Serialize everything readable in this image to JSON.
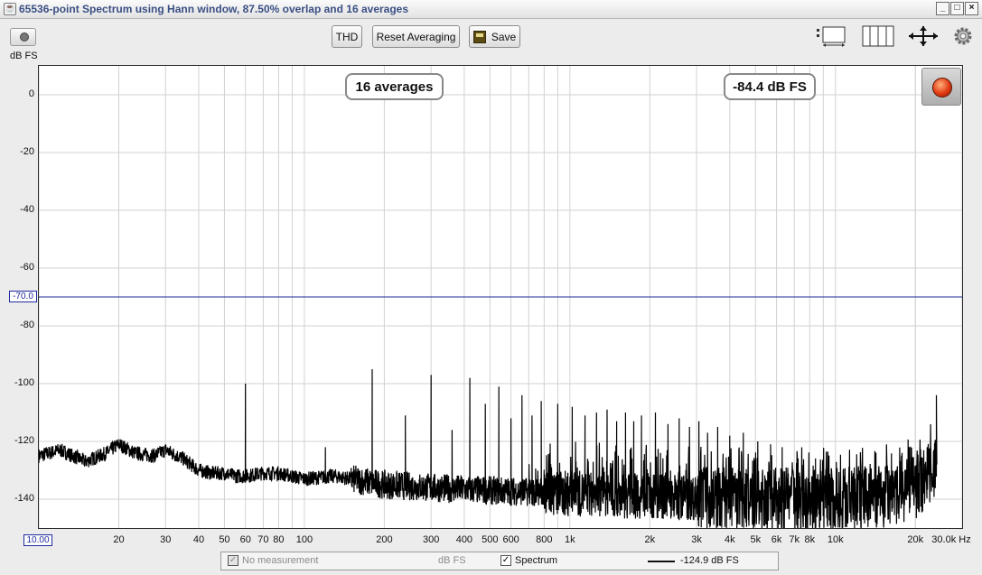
{
  "window": {
    "title": "65536-point Spectrum using Hann window, 87.50% overlap and 16 averages"
  },
  "toolbar": {
    "thd_label": "THD",
    "reset_label": "Reset Averaging",
    "save_label": "Save",
    "y_unit_label": "dB FS"
  },
  "icons": {
    "app": "java-icon",
    "camera": "camera-icon",
    "layout": "layout-icon",
    "columns": "columns-icon",
    "expand": "expand-arrows-icon",
    "settings": "gear-icon",
    "record": "record-icon"
  },
  "callouts": {
    "averages": "16 averages",
    "level": "-84.4 dB FS"
  },
  "markers": {
    "y_cursor": "-70.0",
    "x_cursor": "10.00"
  },
  "legend": {
    "no_measurement": "No measurement",
    "unit": "dB FS",
    "spectrum": "Spectrum",
    "spectrum_value": "-124.9 dB FS",
    "no_measurement_checked": true,
    "spectrum_checked": true
  },
  "colors": {
    "title_text": "#3a4f84",
    "trace": "#000000",
    "cursor": "#1d2a9e",
    "grid": "#d2d2d2"
  },
  "chart_data": {
    "type": "line",
    "x_scale": "log",
    "xlim": [
      10,
      30000
    ],
    "ylim": [
      -150,
      10
    ],
    "y_ticks": [
      0,
      -20,
      -40,
      -60,
      -80,
      -100,
      -120,
      -140
    ],
    "y_tick_labels": [
      "0",
      "-20",
      "-40",
      "-60",
      "-80",
      "-100",
      "-120",
      "-140"
    ],
    "x_ticks": [
      20,
      30,
      40,
      50,
      60,
      70,
      80,
      100,
      200,
      300,
      400,
      500,
      600,
      800,
      1000,
      2000,
      3000,
      4000,
      5000,
      6000,
      7000,
      8000,
      10000,
      20000
    ],
    "x_tick_labels": [
      "20",
      "30",
      "40",
      "50",
      "60",
      "70",
      "80",
      "100",
      "200",
      "300",
      "400",
      "500",
      "600",
      "800",
      "1k",
      "2k",
      "3k",
      "4k",
      "5k",
      "6k",
      "7k",
      "8k",
      "10k",
      "20k"
    ],
    "x_axis_end_label": "30.0k Hz",
    "cursor_y": -70,
    "noise_floor": [
      [
        10,
        -125
      ],
      [
        12,
        -123
      ],
      [
        15,
        -127
      ],
      [
        18,
        -124
      ],
      [
        20,
        -121
      ],
      [
        23,
        -124
      ],
      [
        27,
        -125
      ],
      [
        30,
        -123
      ],
      [
        35,
        -126
      ],
      [
        40,
        -130
      ],
      [
        45,
        -131
      ],
      [
        50,
        -131
      ],
      [
        55,
        -132
      ],
      [
        60,
        -132
      ],
      [
        70,
        -131
      ],
      [
        80,
        -131
      ],
      [
        100,
        -133
      ],
      [
        130,
        -132
      ],
      [
        150,
        -133
      ],
      [
        200,
        -135
      ],
      [
        300,
        -136
      ],
      [
        500,
        -137
      ],
      [
        1000,
        -138
      ],
      [
        2000,
        -139
      ],
      [
        5000,
        -140
      ],
      [
        10000,
        -140
      ],
      [
        15000,
        -139
      ],
      [
        20000,
        -136
      ],
      [
        22000,
        -133
      ],
      [
        24000,
        -128
      ]
    ],
    "peaks": [
      {
        "f": 60,
        "db": -100
      },
      {
        "f": 120,
        "db": -122
      },
      {
        "f": 180,
        "db": -95
      },
      {
        "f": 240,
        "db": -111
      },
      {
        "f": 300,
        "db": -97
      },
      {
        "f": 360,
        "db": -116
      },
      {
        "f": 420,
        "db": -98
      },
      {
        "f": 480,
        "db": -107
      },
      {
        "f": 540,
        "db": -101
      },
      {
        "f": 600,
        "db": -112
      },
      {
        "f": 660,
        "db": -104
      },
      {
        "f": 720,
        "db": -111
      },
      {
        "f": 780,
        "db": -106
      },
      {
        "f": 900,
        "db": -107
      },
      {
        "f": 1020,
        "db": -108
      },
      {
        "f": 1140,
        "db": -111
      },
      {
        "f": 1260,
        "db": -110
      },
      {
        "f": 1380,
        "db": -109
      },
      {
        "f": 1500,
        "db": -113
      },
      {
        "f": 1620,
        "db": -110
      },
      {
        "f": 1740,
        "db": -113
      },
      {
        "f": 1860,
        "db": -111
      },
      {
        "f": 2100,
        "db": -110
      },
      {
        "f": 2340,
        "db": -114
      },
      {
        "f": 2580,
        "db": -112
      },
      {
        "f": 2820,
        "db": -115
      },
      {
        "f": 3060,
        "db": -113
      },
      {
        "f": 3300,
        "db": -117
      },
      {
        "f": 3600,
        "db": -115
      },
      {
        "f": 4000,
        "db": -118
      },
      {
        "f": 4500,
        "db": -117
      },
      {
        "f": 5100,
        "db": -120
      },
      {
        "f": 5700,
        "db": -121
      },
      {
        "f": 6300,
        "db": -122
      },
      {
        "f": 24000,
        "db": -104
      }
    ]
  }
}
